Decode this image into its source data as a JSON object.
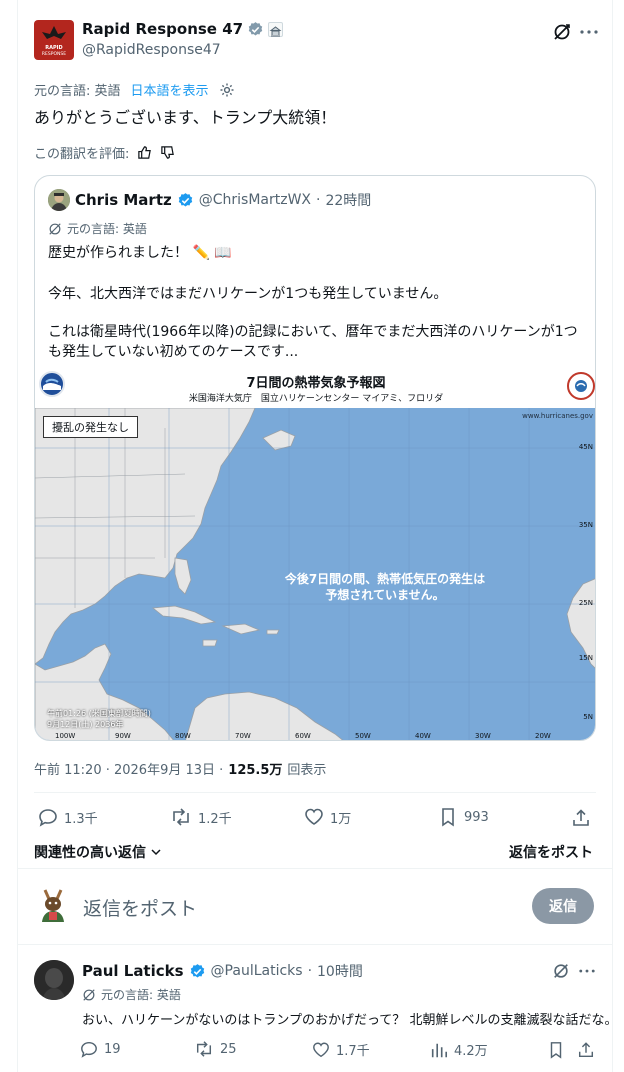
{
  "post": {
    "display_name": "Rapid Response 47",
    "handle": "@RapidResponse47",
    "avatar_text": "RAPID RESPONSE",
    "original_lang": "元の言語: 英語",
    "show_japanese": "日本語を表示",
    "text": "ありがとうございます、トランプ大統領！",
    "rate_translation": "この翻訳を評価:",
    "timestamp": "午前 11:20 · 2026年9月 13日 ·",
    "views_count": "125.5万",
    "views_label": "回表示"
  },
  "quote": {
    "display_name": "Chris Martz",
    "handle": "@ChrisMartzWX",
    "time": "22時間",
    "original_lang": "元の言語: 英語",
    "line1": "歴史が作られました！ ✏️ 📖",
    "line2": "今年、北大西洋ではまだハリケーンが1つも発生していません。",
    "line3": "これは衛星時代(1966年以降)の記録において、暦年でまだ大西洋のハリケーンが1つも発生していない初めてのケースです..."
  },
  "map": {
    "title": "7日間の熱帯気象予報図",
    "subtitle": "米国海洋大気庁　国立ハリケーンセンター マイアミ、フロリダ",
    "url": "www.hurricanes.gov",
    "no_disturbance": "擾乱の発生なし",
    "center_text_1": "今後7日間の間、熱帯低気圧の発生は",
    "center_text_2": "予想されていません。",
    "footer_1": "午前01:26 (米国東部夏時間)",
    "footer_2": "9月12日(土) 2036年",
    "lat_labels": [
      "45N",
      "35N",
      "25N",
      "15N",
      "5N"
    ],
    "lon_labels": [
      "100W",
      "90W",
      "80W",
      "70W",
      "60W",
      "50W",
      "40W",
      "30W",
      "20W"
    ],
    "ocean_color": "#7aa9d8",
    "land_color": "#e6e6e6"
  },
  "actions": {
    "reply": "1.3千",
    "repost": "1.2千",
    "like": "1万",
    "bookmark": "993"
  },
  "sort": {
    "label": "関連性の高い返信",
    "post_reply": "返信をポスト"
  },
  "composer": {
    "placeholder": "返信をポスト",
    "button": "返信"
  },
  "reply": {
    "display_name": "Paul Laticks",
    "handle": "@PaulLaticks",
    "time": "10時間",
    "original_lang": "元の言語: 英語",
    "text": "おい、ハリケーンがないのはトランプのおかげだって？ 北朝鮮レベルの支離滅裂な話だな。",
    "replies": "19",
    "reposts": "25",
    "likes": "1.7千",
    "views": "4.2万"
  }
}
